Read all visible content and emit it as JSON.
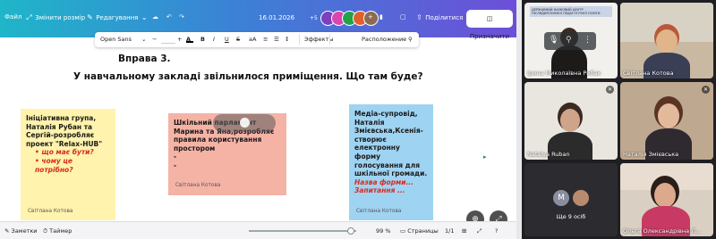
{
  "toolbar": {
    "file": "Файл",
    "resize": "Змінити розмір",
    "edit_mode": "Редагування",
    "date": "16.01.2026",
    "extra_count": "+5",
    "share": "Поділитися",
    "assign": "Призначити"
  },
  "format_bar": {
    "font": "Open Sans",
    "minus": "−",
    "plus": "+",
    "bold": "B",
    "italic": "I",
    "underline": "U",
    "strike": "S",
    "case": "aA",
    "effects": "Эффекты",
    "position": "Расположение"
  },
  "canvas": {
    "title": "Вправа 3.",
    "question": "У навчальному закладі звільнилося приміщення. Що там буде?",
    "notes": {
      "yellow": {
        "text": "Ініціативна група, Наталія Рубан та Сергій-розробляє проект \"Relax-HUB\"",
        "bullet1": "що має бути?",
        "bullet2": "чому це потрібно?",
        "author": "Світлана Котова"
      },
      "pink": {
        "text": "Шкільний парламент Марина та  Яна,розробляє правила користування  простором",
        "dash1": "-",
        "dash2": "-",
        "author": "Світлана Котова"
      },
      "blue": {
        "text": "Медіа-супровід, Наталія Змієвська,Ксенія-створює електронну форму голосування для шкільної громади.",
        "red1": "Назва  форми...",
        "red2": "Запитання ...",
        "author": "Світлана Котова"
      }
    }
  },
  "bottom_bar": {
    "notes": "Заметки",
    "timer": "Таймер",
    "zoom": "99 %",
    "pages": "Страницы",
    "page_count": "1/1"
  },
  "video": {
    "banner_text": "ДЕРЖАВНИЙ НАУКОВИЙ ЦЕНТР ПІСЛЯДИПЛОМНОЇ ПЕДАГОГІЧНОЇ ОСВІТИ",
    "participants": [
      {
        "name": "Ірина Миколаївна Рибак"
      },
      {
        "name": "Світлана Котова"
      },
      {
        "name": "Natalya Ruban"
      },
      {
        "name": "Наталія Змієвська"
      },
      {
        "name": ""
      },
      {
        "name": "Ольга Олександрівна Л..."
      }
    ],
    "more": "Ще 9 осіб",
    "more_initial": "M"
  },
  "colors": {
    "toolbar_start": "#1fb6c9",
    "toolbar_end": "#6d4fd8",
    "note_yellow": "#fff3ad",
    "note_pink": "#f5b3a6",
    "note_blue": "#9fd3f2",
    "accent_red": "#d62b1e"
  }
}
